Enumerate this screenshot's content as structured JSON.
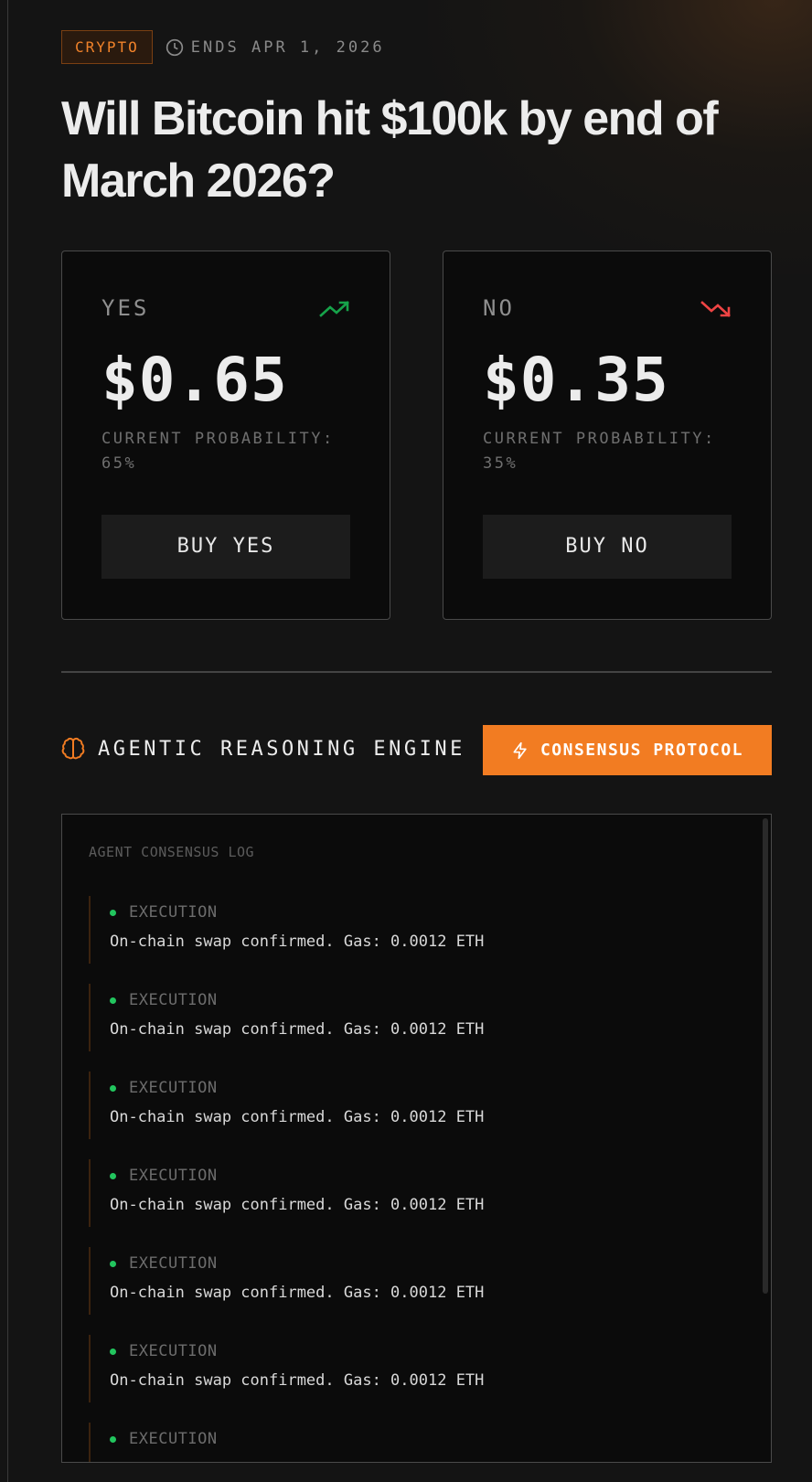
{
  "market": {
    "category": "CRYPTO",
    "ends": "ENDS APR 1, 2026",
    "title": "Will Bitcoin hit $100k by end of March 2026?"
  },
  "outcomes": {
    "yes": {
      "label": "YES",
      "price": "$0.65",
      "prob_label": "CURRENT PROBABILITY:",
      "prob_value": "65%",
      "button": "BUY YES",
      "trend_icon": "trending-up-icon",
      "trend_color": "#16a34a"
    },
    "no": {
      "label": "NO",
      "price": "$0.35",
      "prob_label": "CURRENT PROBABILITY:",
      "prob_value": "35%",
      "button": "BUY NO",
      "trend_icon": "trending-down-icon",
      "trend_color": "#ef4444"
    }
  },
  "engine": {
    "title": "AGENTIC REASONING ENGINE",
    "button": "CONSENSUS PROTOCOL",
    "accent": "#f27c22"
  },
  "log": {
    "title": "AGENT CONSENSUS LOG",
    "entries": [
      {
        "type": "EXECUTION",
        "message": "On-chain swap confirmed. Gas: 0.0012 ETH"
      },
      {
        "type": "EXECUTION",
        "message": "On-chain swap confirmed. Gas: 0.0012 ETH"
      },
      {
        "type": "EXECUTION",
        "message": "On-chain swap confirmed. Gas: 0.0012 ETH"
      },
      {
        "type": "EXECUTION",
        "message": "On-chain swap confirmed. Gas: 0.0012 ETH"
      },
      {
        "type": "EXECUTION",
        "message": "On-chain swap confirmed. Gas: 0.0012 ETH"
      },
      {
        "type": "EXECUTION",
        "message": "On-chain swap confirmed. Gas: 0.0012 ETH"
      },
      {
        "type": "EXECUTION",
        "message": ""
      }
    ]
  }
}
